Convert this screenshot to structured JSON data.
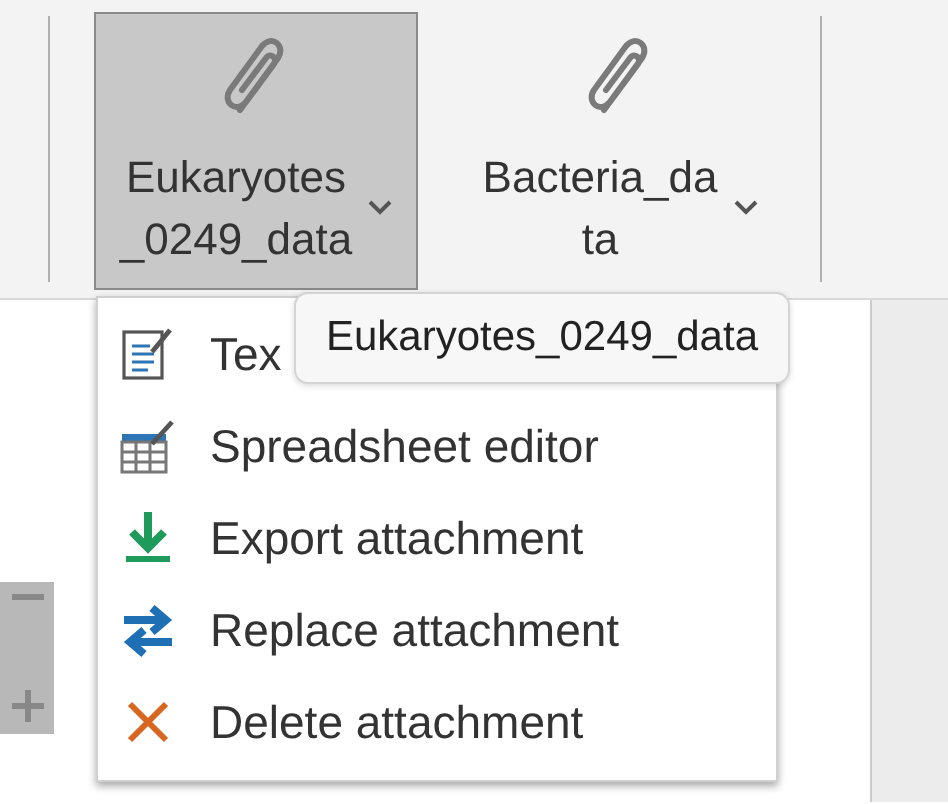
{
  "ribbon": {
    "buttons": [
      {
        "label_lines": [
          "Eukaryotes",
          "_0249_data"
        ],
        "selected": true
      },
      {
        "label_lines": [
          "Bacteria_da",
          "ta"
        ],
        "selected": false
      }
    ]
  },
  "menu": {
    "items": [
      {
        "label": "Tex",
        "kind": "text"
      },
      {
        "label": "Spreadsheet editor",
        "kind": "sheet"
      },
      {
        "label": "Export attachment",
        "kind": "export"
      },
      {
        "label": "Replace attachment",
        "kind": "replace"
      },
      {
        "label": "Delete attachment",
        "kind": "delete"
      }
    ]
  },
  "tooltip": {
    "text": "Eukaryotes_0249_data"
  }
}
